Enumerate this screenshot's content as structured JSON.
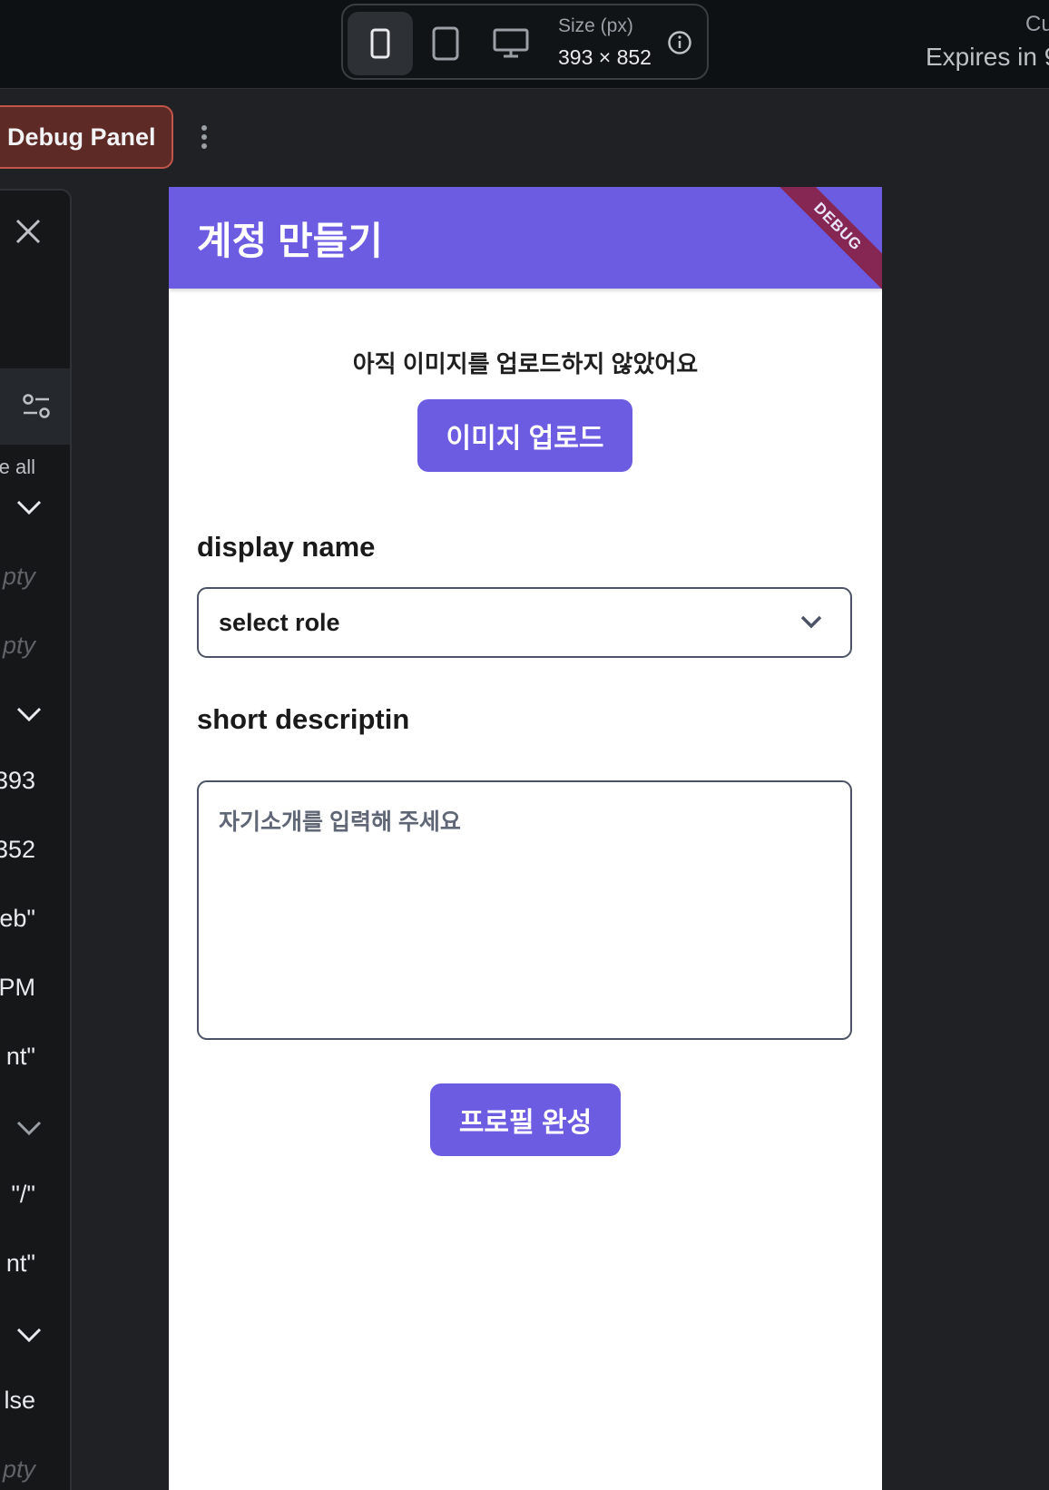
{
  "toolbar": {
    "size_label": "Size (px)",
    "size_value": "393 × 852",
    "device_buttons": [
      "phone-icon",
      "tablet-icon",
      "desktop-icon"
    ],
    "active_device": "phone",
    "corner_top": "Cu",
    "expires": "Expires in 9"
  },
  "debug_panel": {
    "button_label": "Debug Panel",
    "menu_icon": "more-vert-icon"
  },
  "sidepanel": {
    "collapse_all": "pse all",
    "items": [
      {
        "text": "pty",
        "muted": true
      },
      {
        "text": "pty",
        "muted": true
      },
      {
        "text": "393"
      },
      {
        "text": "352"
      },
      {
        "text": "eb\""
      },
      {
        "text": "PM"
      },
      {
        "text": "nt\""
      },
      {
        "text": "\"/\""
      },
      {
        "text": "nt\""
      },
      {
        "text": "lse"
      },
      {
        "text": "pty",
        "muted": true
      }
    ]
  },
  "app": {
    "title": "계정 만들기",
    "debug_banner": "DEBUG",
    "no_image_text": "아직 이미지를 업로드하지 않았어요",
    "upload_button": "이미지 업로드",
    "display_name_label": "display name",
    "role_select_value": "select role",
    "short_desc_label": "short descriptin",
    "short_desc_placeholder": "자기소개를 입력해 주세요",
    "complete_button": "프로필 완성",
    "accent_color": "#6c5ce2"
  }
}
